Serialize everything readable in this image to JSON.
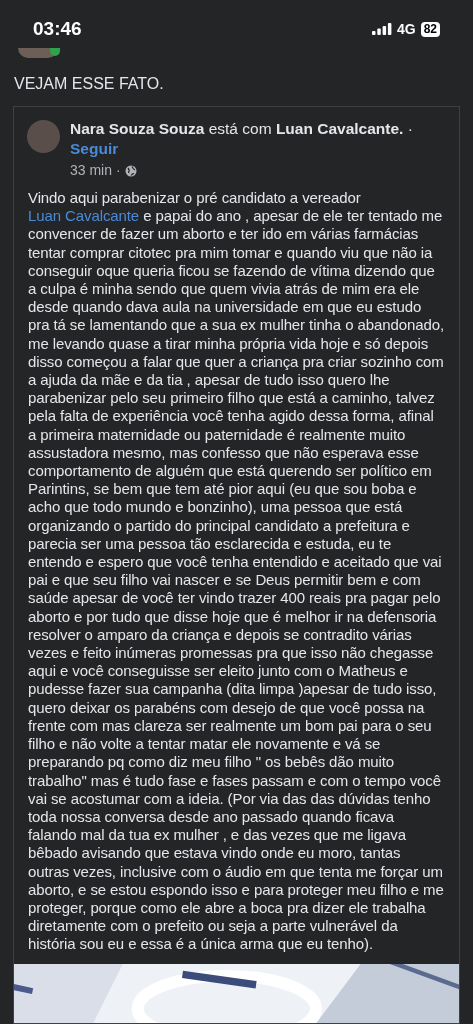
{
  "status_bar": {
    "time": "03:46",
    "network": "4G",
    "battery": "82"
  },
  "post": {
    "text": "VEJAM ESSE FATO.",
    "shared_post": {
      "author": "Nara Souza Souza",
      "with_text": "está com",
      "tagged": "Luan Cavalcante.",
      "header_separator": "·",
      "follow": "Seguir",
      "time": "33 min",
      "time_separator": "·",
      "body_before": "Vindo aqui parabenizar o pré candidato a vereador",
      "body_link": "Luan Cavalcante",
      "body_after": " e papai do ano , apesar de ele ter tentado me convencer de fazer um aborto e ter ido em várias farmácias tentar comprar citotec pra mim tomar e quando viu que não ia conseguir oque queria ficou se fazendo de vítima dizendo que a culpa é minha sendo que quem vivia atrás de mim era ele desde quando dava aula na universidade em que eu estudo pra tá se lamentando que a sua ex mulher tinha o abandonado, me levando quase a tirar minha própria vida hoje e só depois disso começou a falar que quer a criança pra criar sozinho com a ajuda da mãe e da tia , apesar de tudo isso quero lhe parabenizar pelo seu primeiro filho que está a caminho, talvez pela falta de experiência você tenha agido dessa forma, afinal a primeira maternidade ou paternidade é realmente muito assustadora mesmo, mas confesso que não esperava esse comportamento de alguém que está querendo ser político em Parintins, se bem que tem até pior aqui (eu que sou boba e acho que todo mundo e bonzinho), uma pessoa que está organizando o partido do principal candidato a prefeitura e parecia ser uma pessoa tão esclarecida e estuda, eu te entendo e espero que você tenha entendido e aceitado que vai pai e que seu filho vai nascer e se Deus permitir bem e com saúde apesar de você ter vindo trazer 400 reais pra pagar pelo aborto e por tudo que disse hoje que é melhor ir na defensoria resolver o amparo da criança e depois se contradito várias vezes e feito inúmeras promessas pra que isso não chegasse aqui e você conseguisse ser eleito junto com o Matheus  e pudesse fazer sua campanha (dita limpa )apesar de tudo isso, quero deixar os parabéns com desejo de que você possa na frente com mas clareza ser realmente um bom pai para o seu filho e não volte a tentar matar ele novamente e vá se preparando pq como diz meu filho \" os bebês dão muito trabalho\" mas é tudo fase e fases passam e com o tempo você vai se acostumar com a ideia. (Por via das das dúvidas tenho toda nossa conversa desde ano passado quando ficava falando mal da tua ex  mulher , e das vezes que me ligava bêbado avisando que estava vindo onde eu moro, tantas outras vezes, inclusive com o áudio em que tenta me forçar um aborto, e se estou espondo isso e para proteger meu filho e me proteger, porque como ele abre a boca pra dizer ele trabalha diretamente com o prefeito ou seja a parte vulnerável da história sou eu e essa é a única arma que eu tenho)."
    }
  }
}
